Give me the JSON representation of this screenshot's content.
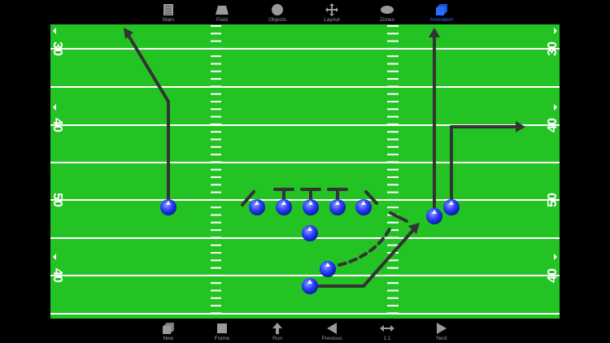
{
  "toolbar_top": {
    "items": [
      {
        "label": "Main",
        "icon": "document-icon"
      },
      {
        "label": "Field",
        "icon": "field-trapezoid-icon"
      },
      {
        "label": "Objects",
        "icon": "circle-icon"
      },
      {
        "label": "Layout",
        "icon": "move-arrows-icon"
      },
      {
        "label": "Zones",
        "icon": "ellipse-icon"
      },
      {
        "label": "Animation",
        "icon": "stacked-cubes-icon",
        "active": true
      }
    ]
  },
  "toolbar_bottom": {
    "items": [
      {
        "label": "New",
        "icon": "new-frames-icon"
      },
      {
        "label": "Frame",
        "icon": "square-icon"
      },
      {
        "label": "Run",
        "icon": "up-arrow-icon"
      },
      {
        "label": "Previous",
        "icon": "left-triangle-icon"
      },
      {
        "label": "1:1",
        "icon": "horizontal-arrows-icon"
      },
      {
        "label": "Next",
        "icon": "right-triangle-icon"
      }
    ]
  },
  "field": {
    "yard_numbers": {
      "top": "30",
      "upper": "40",
      "mid": "50",
      "lower": "40"
    },
    "colors": {
      "grass": "#23c323",
      "lines": "#ffffff",
      "routes": "#333333",
      "player": "#2233ff",
      "active_tool": "#2b6bff"
    }
  }
}
